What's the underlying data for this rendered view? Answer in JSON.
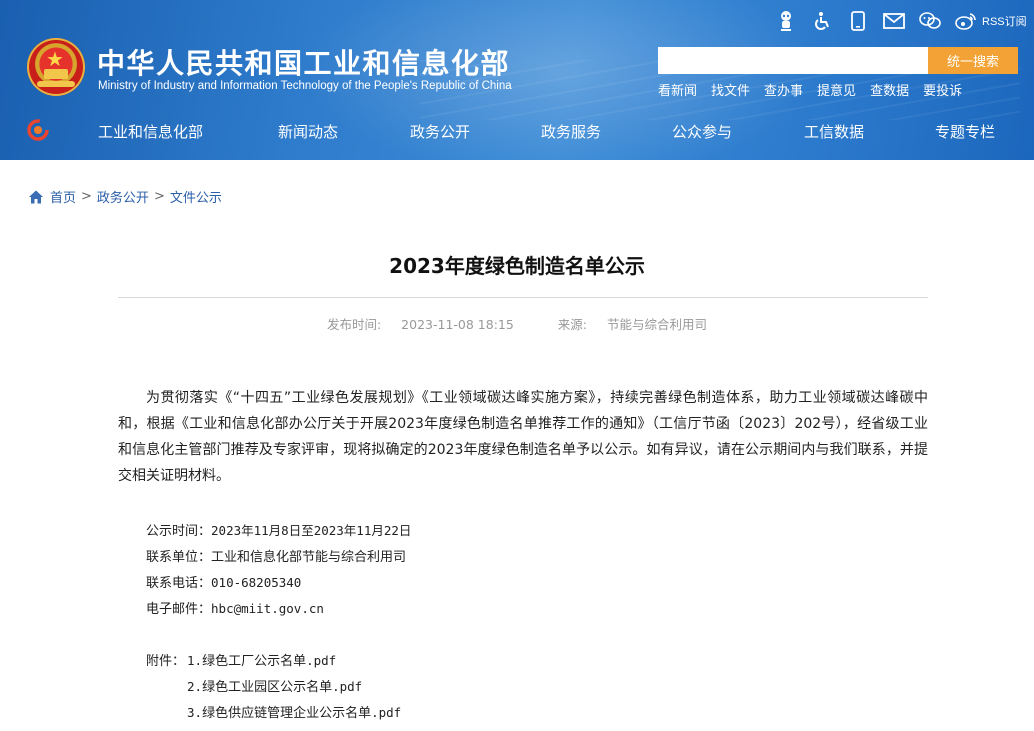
{
  "header": {
    "title": "中华人民共和国工业和信息化部",
    "subtitle": "Ministry of Industry and Information Technology of the People's Republic of China",
    "top_icons": [
      "robot-icon",
      "accessibility-icon",
      "mobile-icon",
      "mail-icon",
      "wechat-icon",
      "weibo-icon"
    ],
    "rss_label": "RSS订阅",
    "search": {
      "placeholder": "",
      "button_label": "统一搜索"
    },
    "quick_links": [
      "看新闻",
      "找文件",
      "查办事",
      "提意见",
      "查数据",
      "要投诉"
    ],
    "nav": [
      "工业和信息化部",
      "新闻动态",
      "政务公开",
      "政务服务",
      "公众参与",
      "工信数据",
      "专题专栏"
    ],
    "colors": {
      "header_blue": "#2f7ccc",
      "search_button": "#f3a335"
    }
  },
  "breadcrumb": {
    "home": "首页",
    "items": [
      "政务公开",
      "文件公示"
    ],
    "separator": ">"
  },
  "article": {
    "title": "2023年度绿色制造名单公示",
    "publish_label": "发布时间:",
    "publish_time": "2023-11-08 18:15",
    "source_label": "来源:",
    "source": "节能与综合利用司",
    "body": "为贯彻落实《“十四五”工业绿色发展规划》《工业领域碳达峰实施方案》，持续完善绿色制造体系，助力工业领域碳达峰碳中和，根据《工业和信息化部办公厅关于开展2023年度绿色制造名单推荐工作的通知》（工信厅节函〔2023〕202号），经省级工业和信息化主管部门推荐及专家评审，现将拟确定的2023年度绿色制造名单予以公示。如有异议，请在公示期间内与我们联系，并提交相关证明材料。",
    "info": [
      {
        "label": "公示时间：",
        "value": "2023年11月8日至2023年11月22日"
      },
      {
        "label": "联系单位：",
        "value": "工业和信息化部节能与综合利用司"
      },
      {
        "label": "联系电话：",
        "value": "010-68205340"
      },
      {
        "label": "电子邮件：",
        "value": "hbc@miit.gov.cn"
      }
    ],
    "attachments_label": "附件：",
    "attachments": [
      {
        "num": "1.",
        "name": "绿色工厂公示名单",
        "ext": ".pdf"
      },
      {
        "num": "2.",
        "name": "绿色工业园区公示名单",
        "ext": ".pdf"
      },
      {
        "num": "3.",
        "name": "绿色供应链管理企业公示名单",
        "ext": ".pdf"
      }
    ]
  }
}
